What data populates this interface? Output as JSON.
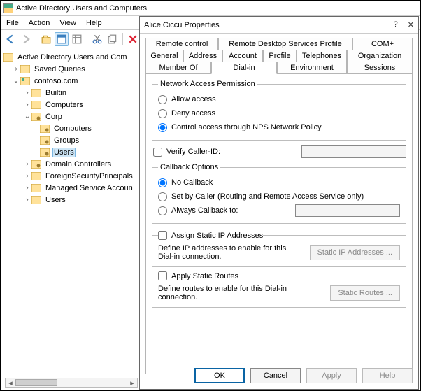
{
  "mmc": {
    "title": "Active Directory Users and Computers",
    "menu": {
      "file": "File",
      "action": "Action",
      "view": "View",
      "help": "Help"
    },
    "tree": {
      "root": "Active Directory Users and Com",
      "savedQueries": "Saved Queries",
      "domain": "contoso.com",
      "builtin": "Builtin",
      "computers": "Computers",
      "corp": "Corp",
      "corpComputers": "Computers",
      "corpGroups": "Groups",
      "corpUsers": "Users",
      "domainControllers": "Domain Controllers",
      "fsp": "ForeignSecurityPrincipals",
      "msa": "Managed Service Accoun",
      "users": "Users"
    }
  },
  "dialog": {
    "title": "Alice Ciccu Properties",
    "tabs_row1": [
      "Remote control",
      "Remote Desktop Services Profile",
      "COM+"
    ],
    "tabs_row2": [
      "General",
      "Address",
      "Account",
      "Profile",
      "Telephones",
      "Organization"
    ],
    "tabs_row3": [
      "Member Of",
      "Dial-in",
      "Environment",
      "Sessions"
    ],
    "activeTab": "Dial-in",
    "nap": {
      "legend": "Network Access Permission",
      "allow": "Allow access",
      "deny": "Deny access",
      "nps": "Control access through NPS Network Policy"
    },
    "verifyCaller": "Verify Caller-ID:",
    "callback": {
      "legend": "Callback Options",
      "none": "No Callback",
      "setByCaller": "Set by Caller (Routing and Remote Access Service only)",
      "always": "Always Callback to:"
    },
    "staticIP": {
      "check": "Assign Static IP Addresses",
      "desc": "Define IP addresses to enable for this Dial-in connection.",
      "btn": "Static IP Addresses ..."
    },
    "staticRoutes": {
      "check": "Apply Static Routes",
      "desc": "Define routes to enable for this Dial-in connection.",
      "btn": "Static Routes ..."
    },
    "buttons": {
      "ok": "OK",
      "cancel": "Cancel",
      "apply": "Apply",
      "help": "Help"
    }
  }
}
